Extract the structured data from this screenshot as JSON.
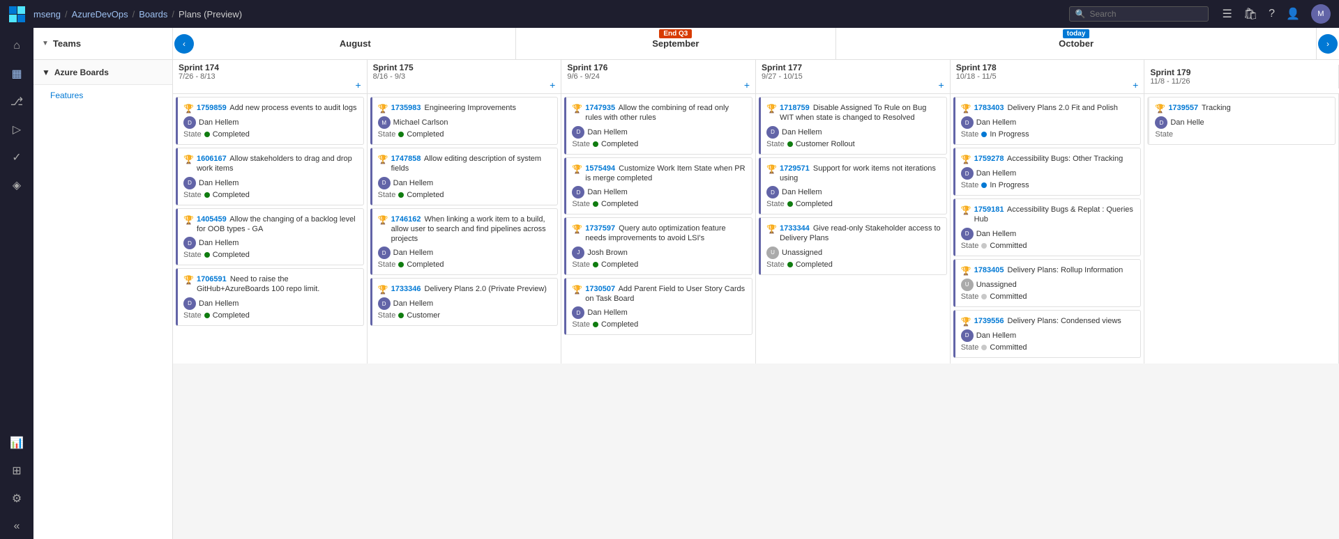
{
  "topNav": {
    "breadcrumbs": [
      "mseng",
      "AzureDevOps",
      "Boards",
      "Plans (Preview)"
    ],
    "searchPlaceholder": "Search"
  },
  "months": [
    "August",
    "September",
    "October"
  ],
  "sprints": [
    {
      "name": "Sprint 174",
      "dates": "7/26 - 8/13"
    },
    {
      "name": "Sprint 175",
      "dates": "8/16 - 9/3"
    },
    {
      "name": "Sprint 176",
      "dates": "9/6 - 9/24"
    },
    {
      "name": "Sprint 177",
      "dates": "9/27 - 10/15"
    },
    {
      "name": "Sprint 178",
      "dates": "10/18 - 11/5"
    },
    {
      "name": "Sprint 179",
      "dates": "11/8 - 11/26"
    }
  ],
  "teams": {
    "label": "Teams",
    "groups": [
      {
        "name": "Azure Boards",
        "items": [
          "Features"
        ]
      }
    ]
  },
  "columns": [
    {
      "sprintIndex": 0,
      "cards": [
        {
          "id": "1759859",
          "title": "Add new process events to audit logs",
          "assignee": "Dan Hellem",
          "state": "Completed",
          "stateType": "completed"
        },
        {
          "id": "1606167",
          "title": "Allow stakeholders to drag and drop work items",
          "assignee": "Dan Hellem",
          "state": "Completed",
          "stateType": "completed"
        },
        {
          "id": "1405459",
          "title": "Allow the changing of a backlog level for OOB types - GA",
          "assignee": "Dan Hellem",
          "state": "Completed",
          "stateType": "completed"
        },
        {
          "id": "1706591",
          "title": "Need to raise the GitHub+AzureBoards 100 repo limit.",
          "assignee": "Dan Hellem",
          "state": "Completed",
          "stateType": "completed"
        }
      ]
    },
    {
      "sprintIndex": 1,
      "cards": [
        {
          "id": "1735983",
          "title": "Engineering Improvements",
          "assignee": "Michael Carlson",
          "state": "Completed",
          "stateType": "completed"
        },
        {
          "id": "1747858",
          "title": "Allow editing description of system fields",
          "assignee": "Dan Hellem",
          "state": "Completed",
          "stateType": "completed"
        },
        {
          "id": "1746162",
          "title": "When linking a work item to a build, allow user to search and find pipelines across projects",
          "assignee": "Dan Hellem",
          "state": "Completed",
          "stateType": "completed"
        },
        {
          "id": "1733346",
          "title": "Delivery Plans 2.0 (Private Preview)",
          "assignee": "Dan Hellem",
          "state": "Customer",
          "stateType": "customer"
        }
      ]
    },
    {
      "sprintIndex": 2,
      "cards": [
        {
          "id": "1747935",
          "title": "Allow the combining of read only rules with other rules",
          "assignee": "Dan Hellem",
          "state": "Completed",
          "stateType": "completed"
        },
        {
          "id": "1575494",
          "title": "Customize Work Item State when PR is merge completed",
          "assignee": "Dan Hellem",
          "state": "Completed",
          "stateType": "completed"
        },
        {
          "id": "1737597",
          "title": "Query auto optimization feature needs improvements to avoid LSI's",
          "assignee": "Josh Brown",
          "state": "Completed",
          "stateType": "completed"
        },
        {
          "id": "1730507",
          "title": "Add Parent Field to User Story Cards on Task Board",
          "assignee": "Dan Hellem",
          "state": "Completed",
          "stateType": "completed"
        }
      ]
    },
    {
      "sprintIndex": 3,
      "cards": [
        {
          "id": "1718759",
          "title": "Disable Assigned To Rule on Bug WIT when state is changed to Resolved",
          "assignee": "Dan Hellem",
          "state": "Customer Rollout",
          "stateType": "customer"
        },
        {
          "id": "1729571",
          "title": "Support for work items not iterations using",
          "assignee": "Dan Hellem",
          "state": "Completed",
          "stateType": "completed"
        },
        {
          "id": "1733344",
          "title": "Give read-only Stakeholder access to Delivery Plans",
          "assignee": "Unassigned",
          "state": "Completed",
          "stateType": "completed"
        }
      ]
    },
    {
      "sprintIndex": 4,
      "cards": [
        {
          "id": "1783403",
          "title": "Delivery Plans 2.0 Fit and Polish",
          "assignee": "Dan Hellem",
          "state": "In Progress",
          "stateType": "in-progress"
        },
        {
          "id": "1759278",
          "title": "Accessibility Bugs: Other Tracking",
          "assignee": "Dan Hellem",
          "state": "In Progress",
          "stateType": "in-progress"
        },
        {
          "id": "1759181",
          "title": "Accessibility Bugs & Replat : Queries Hub",
          "assignee": "Dan Hellem",
          "state": "Committed",
          "stateType": "committed"
        },
        {
          "id": "1783405",
          "title": "Delivery Plans: Rollup Information",
          "assignee": "Unassigned",
          "state": "Committed",
          "stateType": "committed"
        },
        {
          "id": "1739556",
          "title": "Delivery Plans: Condensed views",
          "assignee": "Dan Hellem",
          "state": "Committed",
          "stateType": "committed"
        }
      ]
    },
    {
      "sprintIndex": 5,
      "cards": [
        {
          "id": "1739557",
          "title": "Tracking",
          "assignee": "Dan Helle",
          "state": "",
          "stateType": "none"
        }
      ]
    }
  ],
  "sidebarIcons": [
    {
      "name": "home",
      "symbol": "⌂",
      "active": false
    },
    {
      "name": "boards",
      "symbol": "▦",
      "active": true
    },
    {
      "name": "repos",
      "symbol": "⎇",
      "active": false
    },
    {
      "name": "pipelines",
      "symbol": "▷",
      "active": false
    },
    {
      "name": "test",
      "symbol": "✓",
      "active": false
    },
    {
      "name": "artifacts",
      "symbol": "◈",
      "active": false
    },
    {
      "name": "analytics",
      "symbol": "📊",
      "active": false
    },
    {
      "name": "extensions",
      "symbol": "⊞",
      "active": false
    }
  ]
}
